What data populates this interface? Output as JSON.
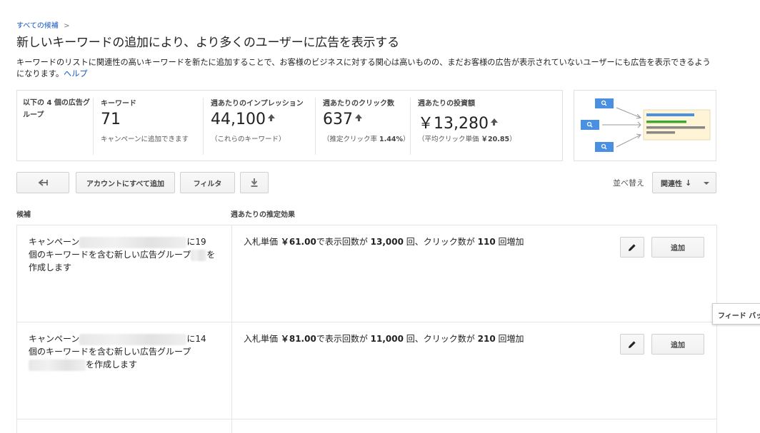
{
  "breadcrumb": {
    "label": "すべての候補",
    "sep": ">"
  },
  "title": "新しいキーワードの追加により、より多くのユーザーに広告を表示する",
  "description": {
    "text": "キーワードのリストに関連性の高いキーワードを新たに追加することで、お客様のビジネスに対する関心は高いものの、まだお客様の広告が表示されていないユーザーにも広告を表示できるようになります。",
    "help": "ヘルプ"
  },
  "stats": {
    "group_label": "以下の 4 個の広告グループ",
    "keywords": {
      "label": "キーワード",
      "value": "71",
      "sub": "キャンペーンに追加できます"
    },
    "impressions": {
      "label": "週あたりのインプレッション",
      "value": "44,100",
      "sub": "（これらのキーワード）"
    },
    "clicks": {
      "label": "週あたりのクリック数",
      "value": "637",
      "sub_prefix": "（推定クリック率",
      "sub_value": "1.44%",
      "sub_suffix": "）"
    },
    "cost": {
      "label": "週あたりの投資額",
      "value": "￥13,280",
      "sub_prefix": "（平均クリック単価",
      "sub_value": "￥20.85",
      "sub_suffix": "）"
    }
  },
  "toolbar": {
    "add_all": "アカウントにすべて追加",
    "filter": "フィルタ",
    "sort_label": "並べ替え",
    "sort_value": "関連性"
  },
  "columns": {
    "candidate": "候補",
    "effect": "週あたりの推定効果"
  },
  "rows": [
    {
      "cand_a": "キャンペーン",
      "cand_b": "に",
      "cand_c": "19 個のキーワードを含む新しい広告グループ",
      "cand_d": "を作成します",
      "eff_a": "入札単価",
      "bid": "￥61.00",
      "eff_b": "で表示回数が",
      "imp": "13,000",
      "eff_c": "回、クリック数が",
      "clk": "110",
      "eff_d": "回増加",
      "add": "追加"
    },
    {
      "cand_a": "キャンペーン",
      "cand_b": "に",
      "cand_c": "14 個のキーワードを含む新しい広告グループ",
      "cand_d": "を作成します",
      "eff_a": "入札単価",
      "bid": "￥81.00",
      "eff_b": "で表示回数が",
      "imp": "11,000",
      "eff_c": "回、クリック数が",
      "clk": "210",
      "eff_d": "回増加",
      "add": "追加"
    }
  ],
  "feedback": "フィード バック",
  "colors": {
    "link": "#1155cc",
    "illus_blue": "#4a90e2",
    "illus_green": "#3aaa35",
    "illus_bg": "#fff5d6"
  }
}
